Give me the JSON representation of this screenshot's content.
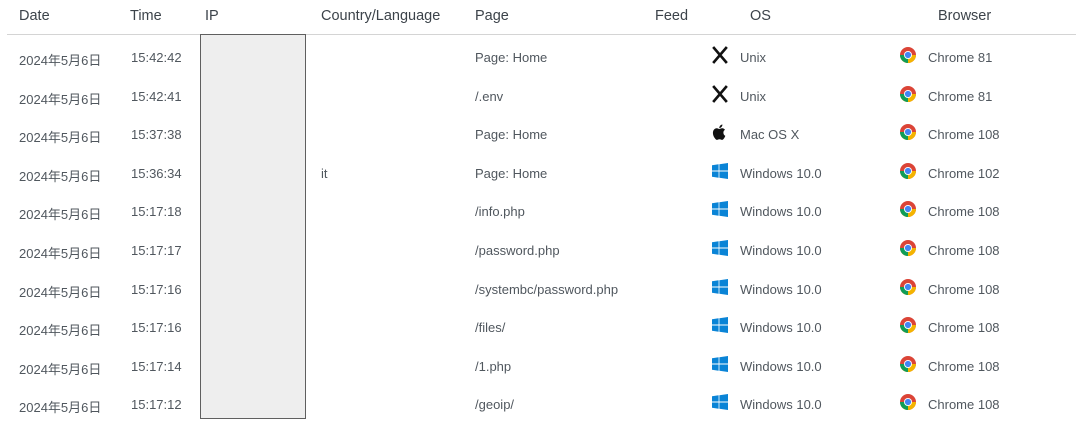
{
  "headers": {
    "date": "Date",
    "time": "Time",
    "ip": "IP",
    "country": "Country/Language",
    "page": "Page",
    "feed": "Feed",
    "os": "OS",
    "browser": "Browser"
  },
  "rows": [
    {
      "date": "2024年5月6日",
      "time": "15:42:42",
      "country": "",
      "page": "Page: Home",
      "os_icon": "x-icon",
      "os": "Unix",
      "browser_icon": "chrome-icon",
      "browser": "Chrome 81"
    },
    {
      "date": "2024年5月6日",
      "time": "15:42:41",
      "country": "",
      "page": "/.env",
      "os_icon": "x-icon",
      "os": "Unix",
      "browser_icon": "chrome-icon",
      "browser": "Chrome 81"
    },
    {
      "date": "2024年5月6日",
      "time": "15:37:38",
      "country": "",
      "page": "Page: Home",
      "os_icon": "apple-icon",
      "os": "Mac OS X",
      "browser_icon": "chrome-icon",
      "browser": "Chrome 108"
    },
    {
      "date": "2024年5月6日",
      "time": "15:36:34",
      "country": "it",
      "page": "Page: Home",
      "os_icon": "windows-icon",
      "os": "Windows 10.0",
      "browser_icon": "chrome-icon",
      "browser": "Chrome 102"
    },
    {
      "date": "2024年5月6日",
      "time": "15:17:18",
      "country": "",
      "page": "/info.php",
      "os_icon": "windows-icon",
      "os": "Windows 10.0",
      "browser_icon": "chrome-icon",
      "browser": "Chrome 108"
    },
    {
      "date": "2024年5月6日",
      "time": "15:17:17",
      "country": "",
      "page": "/password.php",
      "os_icon": "windows-icon",
      "os": "Windows 10.0",
      "browser_icon": "chrome-icon",
      "browser": "Chrome 108"
    },
    {
      "date": "2024年5月6日",
      "time": "15:17:16",
      "country": "",
      "page": "/systembc/password.php",
      "os_icon": "windows-icon",
      "os": "Windows 10.0",
      "browser_icon": "chrome-icon",
      "browser": "Chrome 108"
    },
    {
      "date": "2024年5月6日",
      "time": "15:17:16",
      "country": "",
      "page": "/files/",
      "os_icon": "windows-icon",
      "os": "Windows 10.0",
      "browser_icon": "chrome-icon",
      "browser": "Chrome 108"
    },
    {
      "date": "2024年5月6日",
      "time": "15:17:14",
      "country": "",
      "page": "/1.php",
      "os_icon": "windows-icon",
      "os": "Windows 10.0",
      "browser_icon": "chrome-icon",
      "browser": "Chrome 108"
    },
    {
      "date": "2024年5月6日",
      "time": "15:17:12",
      "country": "",
      "page": "/geoip/",
      "os_icon": "windows-icon",
      "os": "Windows 10.0",
      "browser_icon": "chrome-icon",
      "browser": "Chrome 108"
    }
  ],
  "colors": {
    "windows": "#0a84d6",
    "chrome_red": "#db4437",
    "chrome_green": "#0f9d58",
    "chrome_yellow": "#f4b400",
    "chrome_blue": "#4285f4",
    "ip_redaction": "#eeeeee"
  }
}
